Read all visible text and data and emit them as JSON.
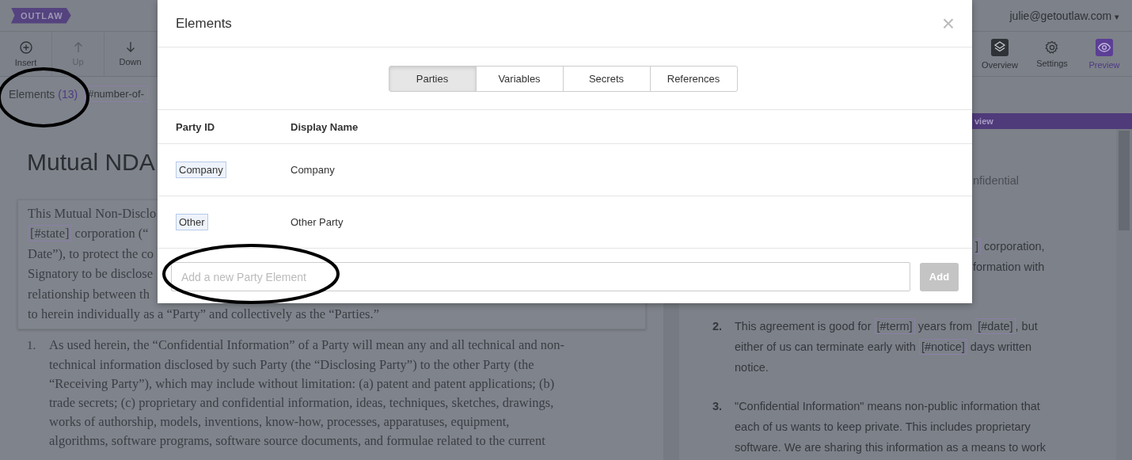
{
  "app": {
    "logo": "OUTLAW",
    "user": "julie@getoutlaw.com",
    "user_caret": "▾"
  },
  "toolbar_left": [
    {
      "label": "Insert",
      "disabled": false
    },
    {
      "label": "Up",
      "disabled": true
    },
    {
      "label": "Down",
      "disabled": false
    }
  ],
  "toolbar_right": [
    {
      "label": "Overview",
      "selected": false
    },
    {
      "label": "Settings",
      "selected": false
    },
    {
      "label": "Preview",
      "selected": true
    }
  ],
  "elements_bar": {
    "label": "Elements",
    "count": "(13)",
    "tag": "#number-of-"
  },
  "editor": {
    "title": "Mutual NDA",
    "intro_lines": [
      [
        {
          "kind": "text",
          "text": "This Mutual Non-Disclo"
        }
      ],
      [
        {
          "kind": "token",
          "text": "[#state]"
        },
        {
          "kind": "text",
          "text": " corporation (“"
        }
      ],
      [
        {
          "kind": "text",
          "text": "Date”), to protect the co"
        }
      ],
      [
        {
          "kind": "text",
          "text": "Signatory to be disclose"
        }
      ],
      [
        {
          "kind": "text",
          "text": "relationship between th"
        }
      ],
      [
        {
          "kind": "text",
          "text": "to herein individually as a “Party” and collectively as the “Parties.”"
        }
      ]
    ],
    "items": [
      {
        "number": "1.",
        "lines": [
          [
            {
              "kind": "text",
              "text": "As used herein, the “Confidential Information” of a Party will mean any and all technical and non-"
            }
          ],
          [
            {
              "kind": "text",
              "text": "technical information disclosed by such Party (the “Disclosing Party”) to the other Party (the"
            }
          ],
          [
            {
              "kind": "text",
              "text": "“Receiving Party”), which may include without limitation: (a) patent and patent applications; (b)"
            }
          ],
          [
            {
              "kind": "text",
              "text": "trade secrets; (c) proprietary and confidential information, ideas, techniques, sketches, drawings,"
            }
          ],
          [
            {
              "kind": "text",
              "text": "works of authorship, models, inventions, know-how, processes, apparatuses, equipment,"
            }
          ],
          [
            {
              "kind": "text",
              "text": "algorithms, software programs, software source documents, and formulae related to the current"
            }
          ]
        ]
      }
    ]
  },
  "preview": {
    "banner": "view",
    "subtitle": "nfidential",
    "fragment_lines": [
      [
        {
          "kind": "token",
          "text": "]"
        },
        {
          "kind": "text",
          "text": " corporation,"
        }
      ],
      [
        {
          "kind": "text",
          "text": "formation with"
        }
      ]
    ],
    "items": [
      {
        "number": "2.",
        "lines": [
          [
            {
              "kind": "text",
              "text": "This agreement is good for "
            },
            {
              "kind": "token",
              "text": "[#term]"
            },
            {
              "kind": "text",
              "text": " years from "
            },
            {
              "kind": "token",
              "text": "[#date]"
            },
            {
              "kind": "text",
              "text": ", but"
            }
          ],
          [
            {
              "kind": "text",
              "text": "either of us can terminate early with "
            },
            {
              "kind": "token",
              "text": "[#notice]"
            },
            {
              "kind": "text",
              "text": " days written"
            }
          ],
          [
            {
              "kind": "text",
              "text": "notice."
            }
          ]
        ]
      },
      {
        "number": "3.",
        "lines": [
          [
            {
              "kind": "text",
              "text": "\"Confidential Information\" means non-public information that"
            }
          ],
          [
            {
              "kind": "text",
              "text": "each of us wants to keep private. This includes proprietary"
            }
          ],
          [
            {
              "kind": "text",
              "text": "software. We are sharing this information as a means to work"
            }
          ]
        ]
      }
    ]
  },
  "modal": {
    "title": "Elements",
    "close": "×",
    "tabs": [
      {
        "label": "Parties",
        "selected": true
      },
      {
        "label": "Variables",
        "selected": false
      },
      {
        "label": "Secrets",
        "selected": false
      },
      {
        "label": "References",
        "selected": false
      }
    ],
    "columns": [
      "Party ID",
      "Display Name"
    ],
    "rows": [
      {
        "id": "Company",
        "name": "Company"
      },
      {
        "id": "Other",
        "name": "Other Party"
      }
    ],
    "input": {
      "placeholder": "Add a new Party Element"
    },
    "add_button": {
      "label": "Add",
      "disabled": true
    }
  }
}
